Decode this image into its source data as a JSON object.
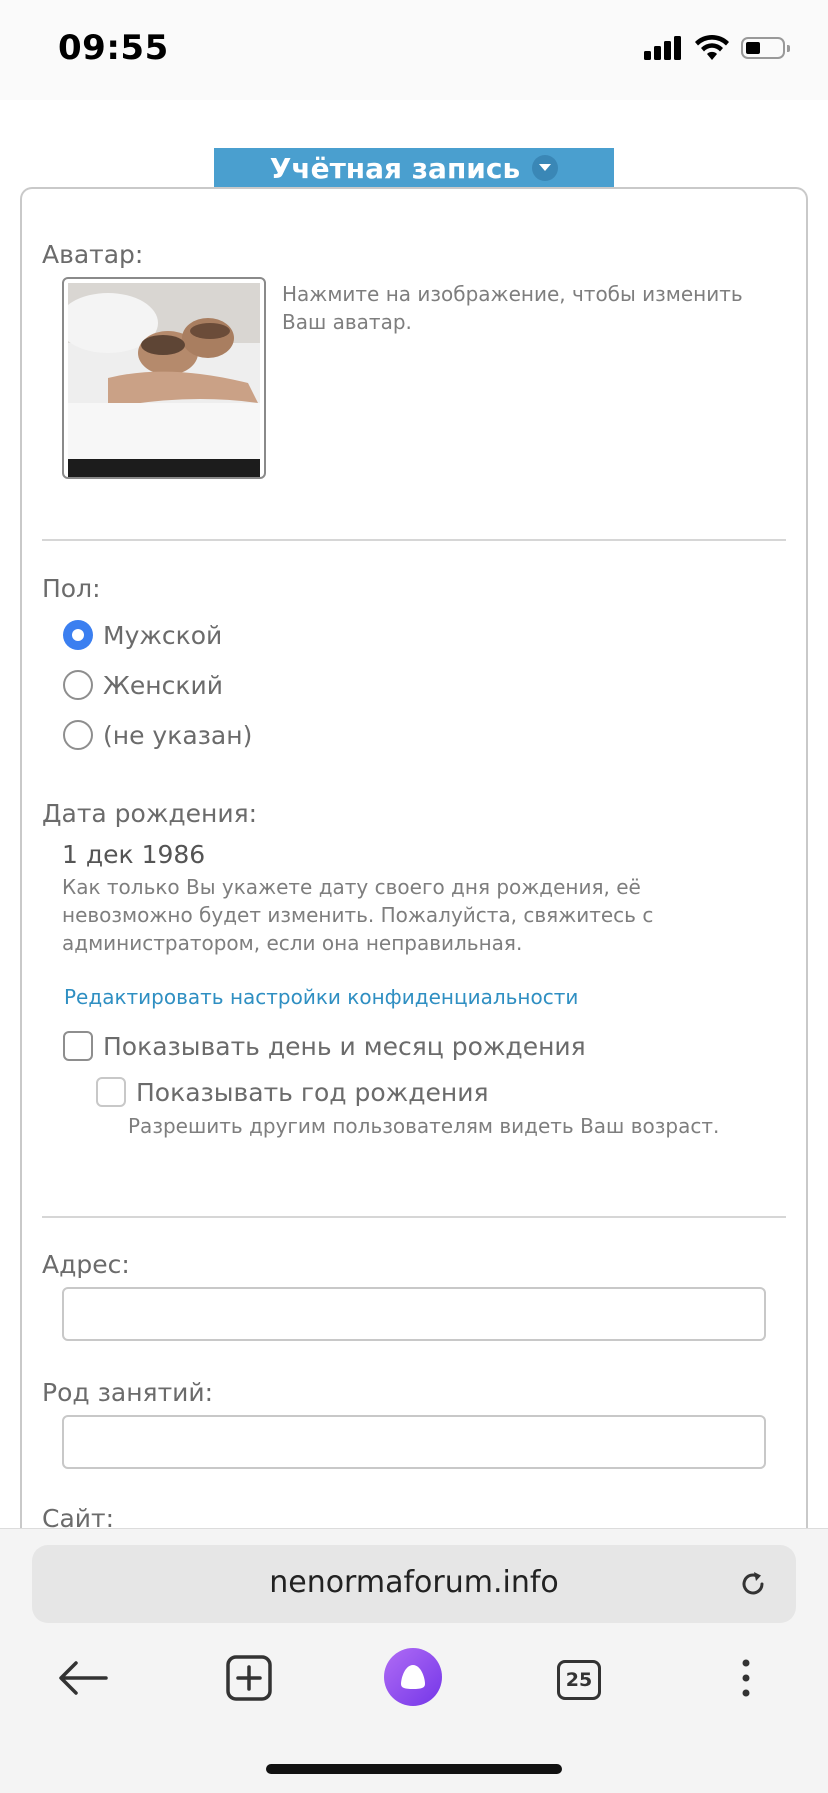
{
  "status_bar": {
    "time": "09:55",
    "icons": [
      "signal-icon",
      "wifi-icon",
      "battery-icon"
    ]
  },
  "section": {
    "title": "Учётная запись",
    "accent_color": "#4a9fcf"
  },
  "avatar": {
    "label": "Аватар:",
    "hint": "Нажмите на изображение, чтобы изменить Ваш аватар."
  },
  "gender": {
    "label": "Пол:",
    "options": [
      "Мужской",
      "Женский",
      "(не указан)"
    ],
    "selected": "Мужской"
  },
  "birthday": {
    "label": "Дата рождения:",
    "value": "1 дек 1986",
    "hint": "Как только Вы укажете дату своего дня рождения, её невозможно будет изменить. Пожалуйста, свяжитесь с администратором, если она неправильная.",
    "privacy_link": "Редактировать настройки конфиденциальности",
    "show_day_month": "Показывать день и месяц рождения",
    "show_year": "Показывать год рождения",
    "show_year_hint": "Разрешить другим пользователям видеть Ваш возраст."
  },
  "address": {
    "label": "Адрес:",
    "value": ""
  },
  "occupation": {
    "label": "Род занятий:",
    "value": ""
  },
  "website": {
    "label": "Сайт:"
  },
  "browser": {
    "url": "nenormaforum.info",
    "tabs_count": "25",
    "assistant_color": "#8b4cf0"
  }
}
